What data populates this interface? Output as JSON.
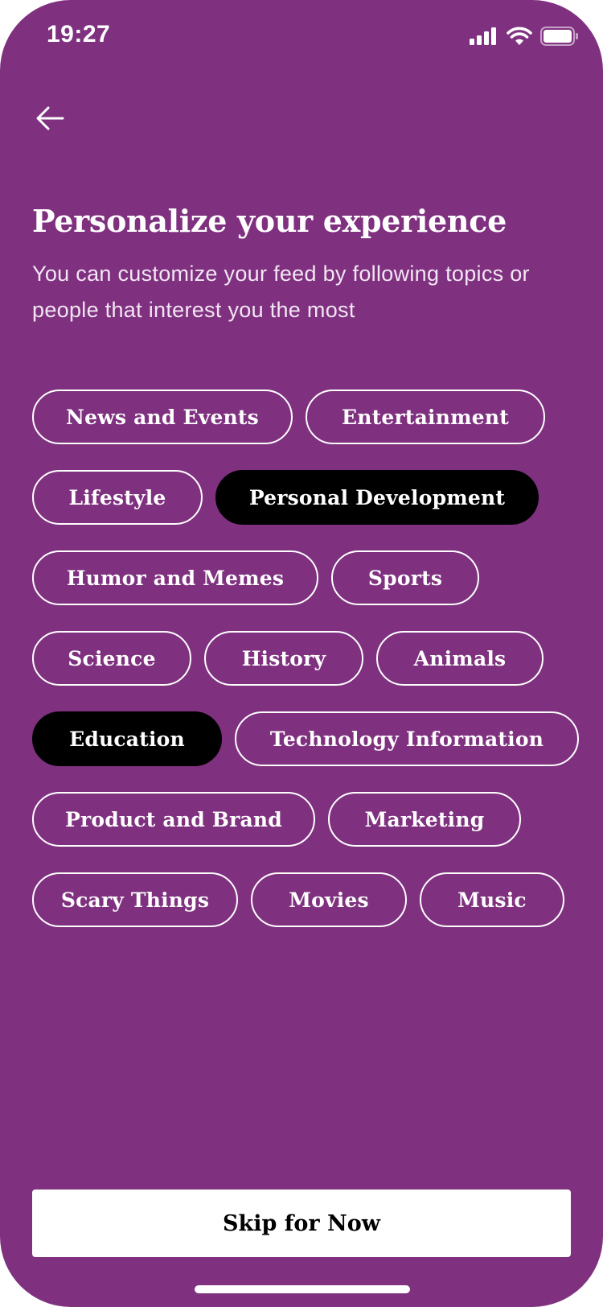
{
  "status_bar": {
    "time": "19:27",
    "icons": [
      "signal-icon",
      "wifi-icon",
      "battery-icon"
    ]
  },
  "header": {
    "back_icon": "arrow-left-icon",
    "title": "Personalize your experience",
    "subtitle": "You can customize your feed by following topics or people that interest you the most"
  },
  "topics": [
    {
      "label": "News and Events",
      "selected": false
    },
    {
      "label": "Entertainment",
      "selected": false
    },
    {
      "label": "Lifestyle",
      "selected": false
    },
    {
      "label": "Personal Development",
      "selected": true
    },
    {
      "label": "Humor and Memes",
      "selected": false
    },
    {
      "label": "Sports",
      "selected": false
    },
    {
      "label": "Science",
      "selected": false
    },
    {
      "label": "History",
      "selected": false
    },
    {
      "label": "Animals",
      "selected": false
    },
    {
      "label": "Education",
      "selected": true
    },
    {
      "label": "Technology Information",
      "selected": false
    },
    {
      "label": "Product and Brand",
      "selected": false
    },
    {
      "label": "Marketing",
      "selected": false
    },
    {
      "label": "Scary Things",
      "selected": false
    },
    {
      "label": "Movies",
      "selected": false
    },
    {
      "label": "Music",
      "selected": false
    }
  ],
  "footer": {
    "skip_label": "Skip for Now"
  },
  "colors": {
    "background": "#7f3180",
    "chip_border": "#ffffff",
    "chip_selected": "#000000",
    "button_bg": "#ffffff"
  }
}
